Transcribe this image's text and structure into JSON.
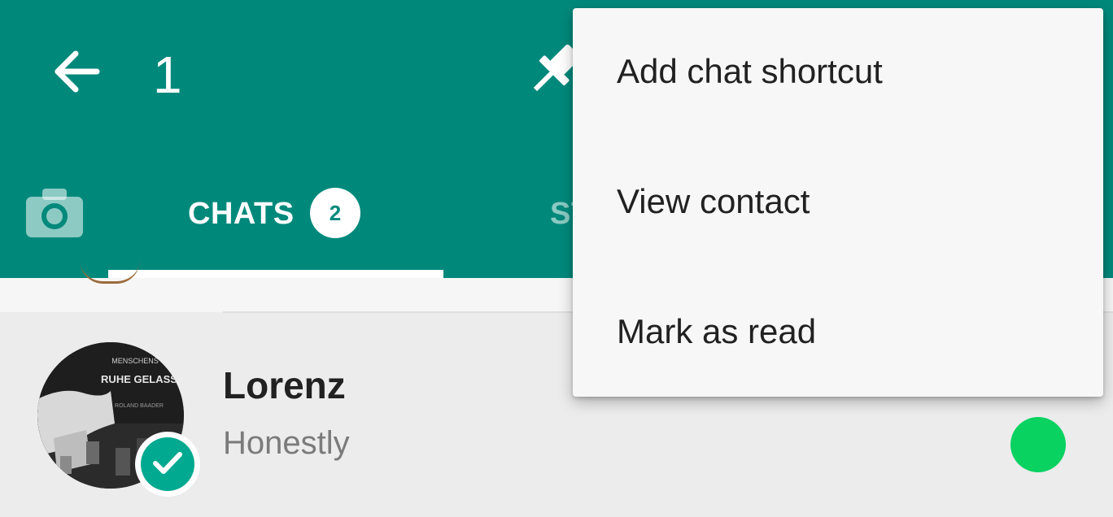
{
  "colors": {
    "brand": "#00897b",
    "tab_indicator": "#ffffff",
    "unread": "#09d261",
    "selected_check": "#00a98f"
  },
  "header": {
    "back_icon": "arrow-back-icon",
    "selected_count": "1",
    "pin_icon": "pin-icon"
  },
  "tabs": {
    "camera_icon": "camera-icon",
    "chats_label": "CHATS",
    "chats_badge": "2",
    "status_label_partial": "ST"
  },
  "chat": {
    "name": "Lorenz",
    "last_message": "Honestly",
    "selected": true,
    "unread": true,
    "avatar_text": [
      "MENSCHENS",
      "RUHE GELASS",
      "ROLAND BAADER"
    ]
  },
  "menu": {
    "items": [
      {
        "label": "Add chat shortcut"
      },
      {
        "label": "View contact"
      },
      {
        "label": "Mark as read"
      }
    ]
  }
}
